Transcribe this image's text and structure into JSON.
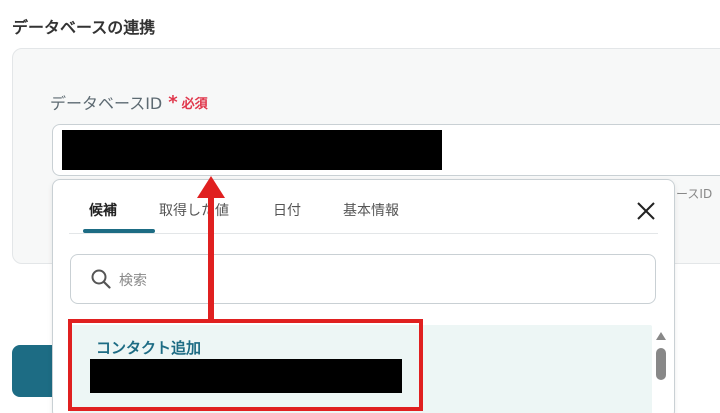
{
  "section_title": "データベースの連携",
  "field": {
    "label": "データベースID",
    "required_star": "*",
    "required_text": "必須",
    "helper_tail": "ースID"
  },
  "dropdown": {
    "tabs": [
      "候補",
      "取得した値",
      "日付",
      "基本情報"
    ],
    "active_tab": "候補",
    "search_placeholder": "検索",
    "items": [
      {
        "title": "コンタクト追加"
      }
    ]
  },
  "colors": {
    "accent": "#1d6c84",
    "required": "#e0364b",
    "annotation": "#e02020",
    "selected_item_bg": "#edf6f5"
  }
}
